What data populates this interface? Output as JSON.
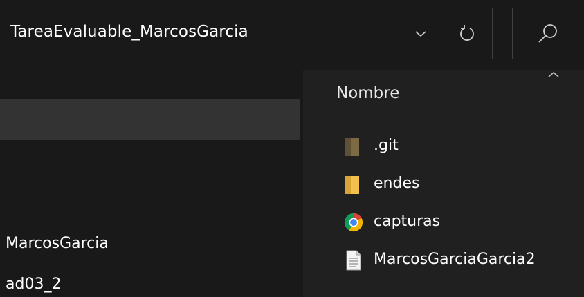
{
  "address_bar": {
    "path": "TareaEvaluable_MarcosGarcia"
  },
  "icons": {
    "dropdown": "chevron-down-icon",
    "refresh": "refresh-icon",
    "search": "search-icon",
    "sort": "sort-ascending-icon"
  },
  "navigation_pane": {
    "items": [
      {
        "label": "MarcosGarcia"
      },
      {
        "label": "ad03_2"
      }
    ]
  },
  "file_list": {
    "column_header": "Nombre",
    "items": [
      {
        "name": ".git",
        "icon": "folder-hidden-icon"
      },
      {
        "name": "endes",
        "icon": "folder-icon"
      },
      {
        "name": "capturas",
        "icon": "chrome-icon"
      },
      {
        "name": "MarcosGarciaGarcia2",
        "icon": "text-document-icon"
      }
    ]
  },
  "colors": {
    "background": "#191919",
    "file_pane": "#202020",
    "selected_row": "#333333",
    "border": "#3f3f3f",
    "folder": "#e8b84c"
  }
}
